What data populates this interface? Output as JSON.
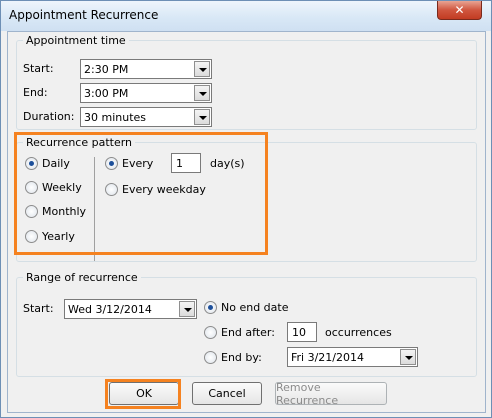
{
  "window": {
    "title": "Appointment Recurrence",
    "close_label": "✕"
  },
  "appointment_time": {
    "legend": "Appointment time",
    "start_label": "Start:",
    "start_value": "2:30 PM",
    "end_label": "End:",
    "end_value": "3:00 PM",
    "duration_label": "Duration:",
    "duration_value": "30 minutes"
  },
  "recurrence_pattern": {
    "legend": "Recurrence pattern",
    "options": [
      "Daily",
      "Weekly",
      "Monthly",
      "Yearly"
    ],
    "selected": "Daily",
    "every_label": "Every",
    "every_value": "1",
    "every_unit": "day(s)",
    "every_weekday_label": "Every weekday"
  },
  "range": {
    "legend": "Range of recurrence",
    "start_label": "Start:",
    "start_value": "Wed 3/12/2014",
    "no_end_label": "No end date",
    "end_after_label": "End after:",
    "end_after_value": "10",
    "occurrences_label": "occurrences",
    "end_by_label": "End by:",
    "end_by_value": "Fri 3/21/2014"
  },
  "buttons": {
    "ok": "OK",
    "cancel": "Cancel",
    "remove": "Remove Recurrence"
  },
  "colors": {
    "highlight": "#f58220",
    "title_bar": "#d9e8f6"
  }
}
